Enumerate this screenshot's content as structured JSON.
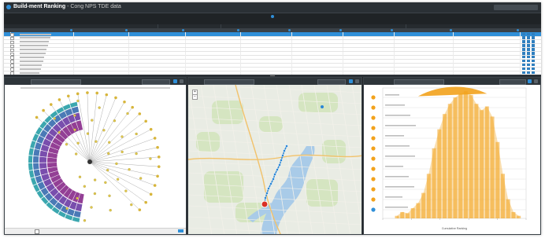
{
  "app": {
    "title": "Build-ment Ranking",
    "page_text": "Cong NPS TDE data"
  },
  "colors": {
    "accent": "#2f8fd8",
    "orange": "#f2a21c",
    "purple": "#7a3a8e",
    "teal": "#2aa0a8"
  },
  "chart_data": {
    "type": "area",
    "x_axis_label": "Cumulative Ranking",
    "series_color": "#f2a21c",
    "x_range_fraction": [
      0,
      1
    ],
    "profile": [
      0.02,
      0.05,
      0.04,
      0.08,
      0.12,
      0.2,
      0.35,
      0.55,
      0.7,
      0.82,
      0.9,
      0.95,
      0.98,
      1.0,
      0.97,
      0.9,
      0.85,
      0.88,
      0.8,
      0.6,
      0.35,
      0.15,
      0.05,
      0.02
    ],
    "ylim": [
      0,
      1
    ]
  }
}
